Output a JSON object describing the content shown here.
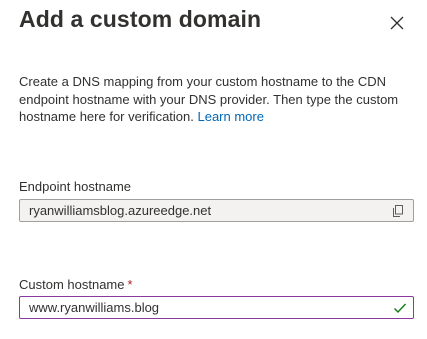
{
  "panel": {
    "title": "Add a custom domain",
    "close_icon": "close-icon"
  },
  "description": {
    "text": "Create a DNS mapping from your custom hostname to the CDN endpoint hostname with your DNS provider. Then type the custom hostname here for verification.",
    "link_label": "Learn more"
  },
  "endpoint": {
    "label": "Endpoint hostname",
    "value": "ryanwilliamsblog.azureedge.net",
    "icon": "copy-icon"
  },
  "custom": {
    "label": "Custom hostname",
    "required_marker": "*",
    "value": "www.ryanwilliams.blog",
    "status_icon": "checkmark-icon"
  },
  "colors": {
    "link": "#0067b8",
    "required": "#a4262c",
    "input_border_focus": "#8a3a9e",
    "valid_check": "#107c10",
    "readonly_bg": "#f3f2f1"
  }
}
